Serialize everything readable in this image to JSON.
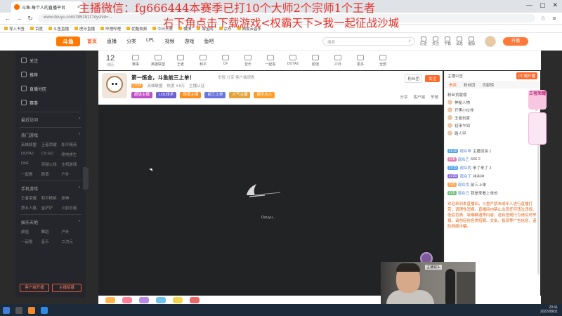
{
  "browser": {
    "tab_title": "斗鱼-每个人的直播平台",
    "tab_close": "×",
    "url": "www.douyu.com/3852811?dyshid=...",
    "win_controls": [
      "—",
      "▢",
      "✕"
    ],
    "bookmarks": [
      "导入书签",
      "百度",
      "斗鱼直播",
      "虎牙直播",
      "哔哩哔哩",
      "优酷视频",
      "今日头条",
      "微博",
      "淘宝网",
      "京东",
      "网易云音乐"
    ]
  },
  "site": {
    "logo": "斗鱼",
    "nav": [
      "首页",
      "直播",
      "分类",
      "LPL",
      "视频",
      "游戏",
      "鱼吧"
    ],
    "search_placeholder": "搜索",
    "header_icons": [
      "历史",
      "关注",
      "下载",
      "消息",
      "客服",
      "开播"
    ],
    "open_button": "开播"
  },
  "sidebar": {
    "top_items": [
      "关注",
      "推荐",
      "直播分区",
      "赛事"
    ],
    "section_recent": "最近访问",
    "section_hot": "热门游戏",
    "hot_games": [
      "英雄联盟",
      "王者荣耀",
      "和平精英",
      "DOTA2",
      "CS:GO",
      "绝地求生",
      "DNF",
      "穿越火线",
      "主机游戏",
      "一起看",
      "颜值",
      "户外"
    ],
    "section_mobile": "手机游戏",
    "mobile_games": [
      "王者荣耀",
      "和平精英",
      "原神",
      "第五人格",
      "金铲铲",
      "火影忍者"
    ],
    "section_ent": "娱乐天地",
    "ent_games": [
      "颜值",
      "舞蹈",
      "户外",
      "一起看",
      "音乐",
      "二次元"
    ],
    "btn_left": "客户端开播",
    "btn_right": "主播招募"
  },
  "category_strip": {
    "day": "12",
    "day_label": "日历",
    "items": [
      "赛事",
      "英雄联盟",
      "王者",
      "和平",
      "CF",
      "音乐",
      "一起看",
      "DOTA2",
      "颜值",
      "户外",
      "更多",
      "全部"
    ]
  },
  "room": {
    "title": "第一炼金，斗鱼前三上单！",
    "meta_right": "举报  分享  客户端观看",
    "level": "LV28",
    "sub": [
      "英雄联盟",
      "热度 4.8万",
      "主播认证"
    ],
    "tags": [
      "超级主播",
      "LOL技术",
      "颜值主播",
      "前三上单",
      "人气主播",
      "娱乐达人"
    ],
    "tag_colors": [
      "#c24ec7",
      "#6b5fd6",
      "#ff8c1a",
      "#6a75dd",
      "#e3a33a",
      "#ff9d2a"
    ],
    "fans": "粉丝团",
    "follow": "关注",
    "actions": [
      "分享",
      "客户端",
      "举报"
    ]
  },
  "video": {
    "loading_text": "Douyu..."
  },
  "right_panel": {
    "top_left": "主播公告",
    "top_right": "PC端开播",
    "tabs": [
      "贵宾",
      "粉丝团",
      "贡献榜"
    ],
    "rank_title": "粉丝贡献榜",
    "ranks": [
      {
        "name": "神秘人物",
        "val": "1"
      },
      {
        "name": "开黑小伙伴",
        "val": "2"
      },
      {
        "name": "王者玩家",
        "val": "3"
      },
      {
        "name": "初来乍到",
        "val": "4"
      },
      {
        "name": "路人甲",
        "val": "5"
      }
    ],
    "chat": [
      {
        "badge": "LV12",
        "badge_color": "#5aa7e8",
        "name": "观众甲",
        "msg": "主播加油 1"
      },
      {
        "badge": "LV8",
        "badge_color": "#e37fb0",
        "name": "观众乙",
        "msg": "666 2"
      },
      {
        "badge": "LV15",
        "badge_color": "#5aa7e8",
        "name": "观众丙",
        "msg": "来了来了 3"
      },
      {
        "badge": "LV20",
        "badge_color": "#8e6bd8",
        "name": "观众丁",
        "msg": "冲冲冲"
      },
      {
        "badge": "LV9",
        "badge_color": "#ffa24a",
        "name": "观众戊",
        "msg": "前三上单"
      },
      {
        "badge": "LV5",
        "badge_color": "#6cc07a",
        "name": "观众己",
        "msg": "我是来看上单的"
      }
    ],
    "system_message": "欢迎来到本直播间，斗鱼严禁未成年人进行直播打赏，请理性消费。直播间内禁止出现任何违法违规、低俗色情、吸烟酗酒等内容，若有违规行为请及时举报。请勿轻信各类招聘、交友、投资等广告信息，谨防网络诈骗。"
  },
  "promo": {
    "label": "王者荣耀"
  },
  "webcam": {
    "caption": "主播镜头"
  },
  "taskbar": {
    "time": "20:41",
    "date": "2022/08/01"
  },
  "overlay": {
    "line1": "主播微信：fg666444本赛季已打10个大师2个宗师1个王者",
    "line2": "右下角点击下载游戏<权霸天下>我一起征战沙城"
  }
}
